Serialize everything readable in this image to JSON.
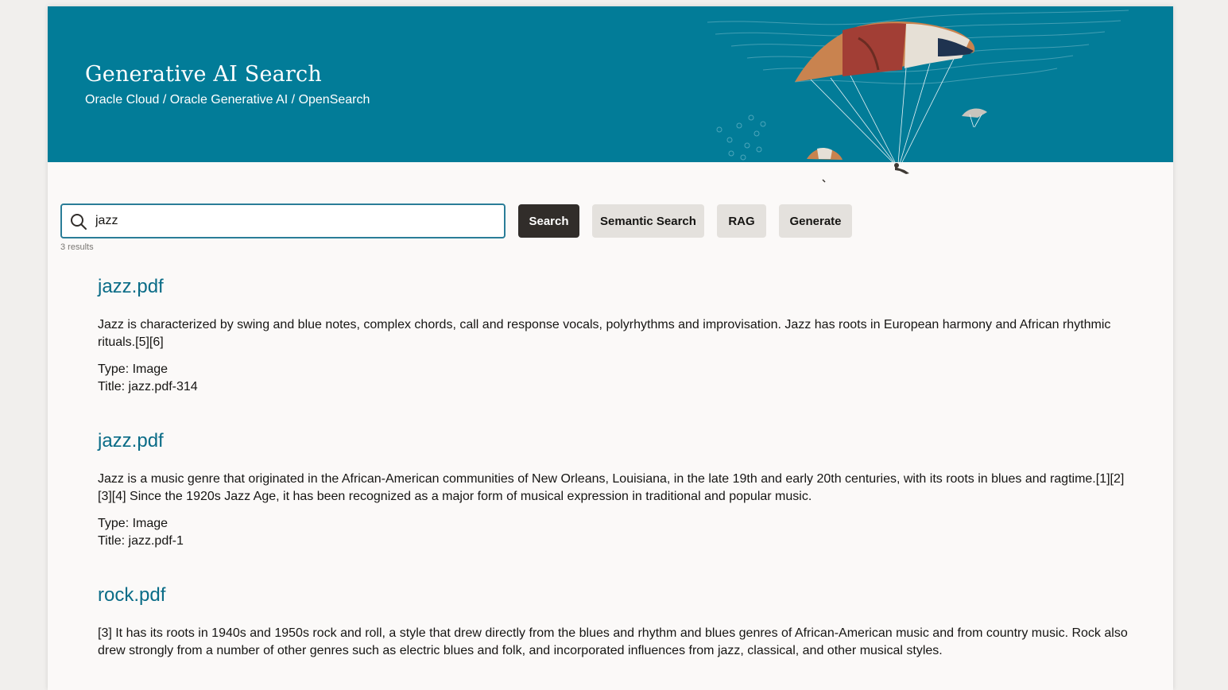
{
  "header": {
    "title": "Generative AI Search",
    "breadcrumb": "Oracle Cloud / Oracle Generative AI / OpenSearch"
  },
  "search": {
    "value": "jazz",
    "placeholder": "",
    "icon": "search-icon"
  },
  "buttons": {
    "search": "Search",
    "semantic": "Semantic Search",
    "rag": "RAG",
    "generate": "Generate"
  },
  "results_count": "3 results",
  "results": [
    {
      "title": "jazz.pdf",
      "snippet": "Jazz is characterized by swing and blue notes, complex chords, call and response vocals, polyrhythms and improvisation. Jazz has roots in European harmony and African rhythmic rituals.[5][6]",
      "type": "Type: Image",
      "doc_title": "Title: jazz.pdf-314"
    },
    {
      "title": "jazz.pdf",
      "snippet": "Jazz is a music genre that originated in the African-American communities of New Orleans, Louisiana, in the late 19th and early 20th centuries, with its roots in blues and ragtime.[1][2][3][4] Since the 1920s Jazz Age, it has been recognized as a major form of musical expression in traditional and popular music.",
      "type": "Type: Image",
      "doc_title": "Title: jazz.pdf-1"
    },
    {
      "title": "rock.pdf",
      "snippet": "[3] It has its roots in 1940s and 1950s rock and roll, a style that drew directly from the blues and rhythm and blues genres of African-American music and from country music. Rock also drew strongly from a number of other genres such as electric blues and folk, and incorporated influences from jazz, classical, and other musical styles.",
      "type": "",
      "doc_title": ""
    }
  ],
  "colors": {
    "banner": "#027c98",
    "primary_button": "#312d2a",
    "secondary_button": "#e4e1dd",
    "link": "#0a6c87"
  }
}
